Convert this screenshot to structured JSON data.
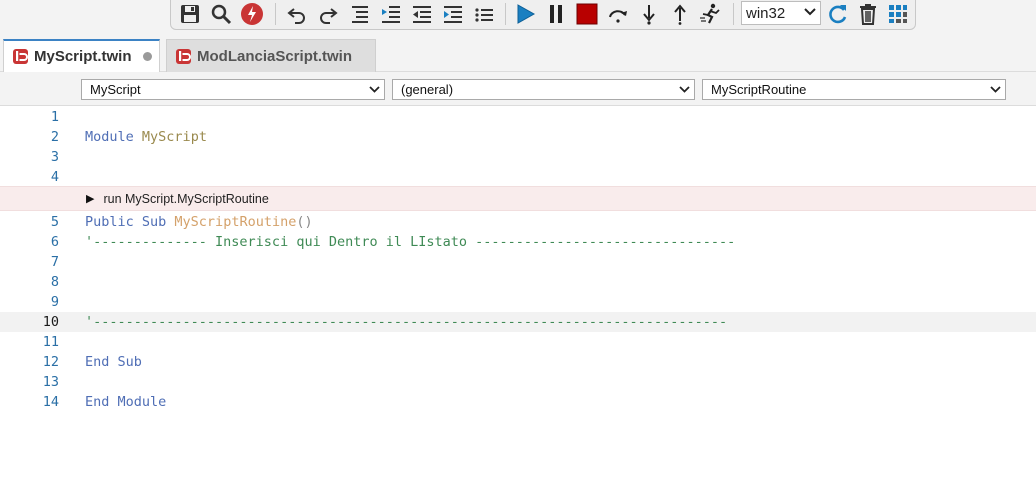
{
  "toolbar": {
    "platform_select": "win32",
    "icons": [
      "save-icon",
      "search-icon",
      "stop-run-icon",
      "undo-icon",
      "redo-icon",
      "align-icon",
      "indent-icon",
      "outdent-left-icon",
      "outdent-right-icon",
      "list-icon",
      "play-icon",
      "pause-icon",
      "stop-icon",
      "step-over-icon",
      "step-into-icon",
      "step-out-icon",
      "run-to-cursor-icon",
      "refresh-icon",
      "trash-icon",
      "grid-icon"
    ],
    "colors": {
      "play": "#1a7fc1",
      "stop": "#b80000",
      "logo": "#c93535"
    }
  },
  "tabs": [
    {
      "label": "MyScript.twin",
      "active": true,
      "modified": true
    },
    {
      "label": "ModLanciaScript.twin",
      "active": false
    }
  ],
  "dropdowns": {
    "module": "MyScript",
    "general": "(general)",
    "routine": "MyScriptRoutine"
  },
  "codelens": {
    "text": "run MyScript.MyScriptRoutine"
  },
  "code_lines": [
    {
      "num": "1",
      "text": ""
    },
    {
      "num": "2",
      "kw": "Module",
      "ident": "MyScript"
    },
    {
      "num": "3",
      "text": ""
    },
    {
      "num": "4",
      "text": ""
    },
    {
      "num": "5",
      "kw": "Public Sub",
      "fn": "MyScriptRoutine",
      "punc": "()"
    },
    {
      "num": "6",
      "comment": "'-------------- Inserisci qui Dentro il LIstato --------------------------------"
    },
    {
      "num": "7",
      "text": ""
    },
    {
      "num": "8",
      "text": ""
    },
    {
      "num": "9",
      "text": ""
    },
    {
      "num": "10",
      "comment": "'------------------------------------------------------------------------------"
    },
    {
      "num": "11",
      "text": ""
    },
    {
      "num": "12",
      "kw": "End Sub"
    },
    {
      "num": "13",
      "text": ""
    },
    {
      "num": "14",
      "kw": "End Module"
    }
  ]
}
